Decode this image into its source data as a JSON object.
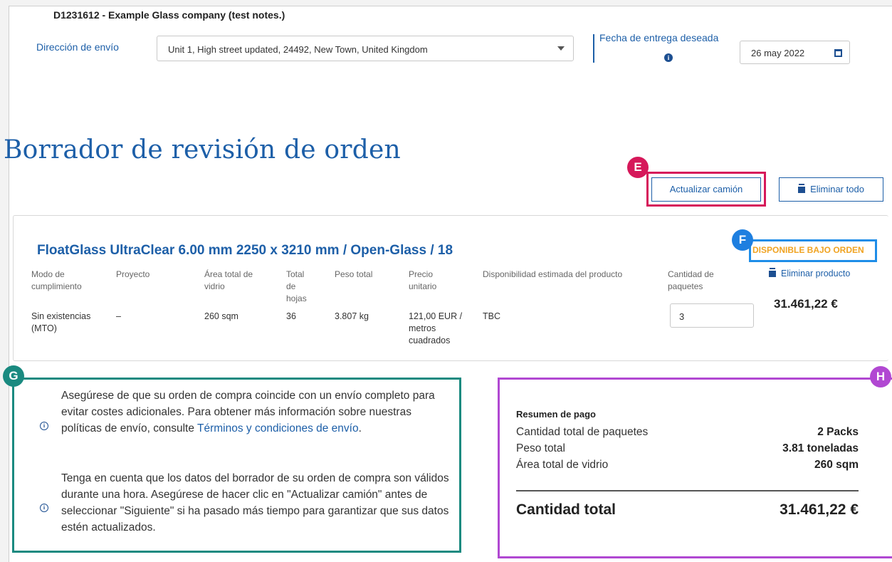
{
  "header": {
    "company": "D1231612 - Example Glass company (test notes.)",
    "shipping_label": "Dirección de envío",
    "shipping_value": "Unit 1, High street updated, 24492, New Town, United Kingdom",
    "delivery_date_label": "Fecha de entrega deseada",
    "delivery_date_value": "26 may 2022"
  },
  "page_title": "Borrador de revisión de orden",
  "badges": {
    "e": "E",
    "f": "F",
    "g": "G",
    "h": "H"
  },
  "actions": {
    "update_truck": "Actualizar camión",
    "delete_all": "Eliminar todo"
  },
  "product": {
    "title": "FloatGlass UltraClear 6.00 mm 2250 x 3210 mm / Open-Glass / 18",
    "availability_tag": "DISPONIBLE BAJO ORDEN",
    "delete_product": "Eliminar producto",
    "line_total": "31.461,22 €",
    "columns": {
      "fulfillment_mode": {
        "header": "Modo de cumplimiento",
        "value": "Sin existencias (MTO)"
      },
      "project": {
        "header": "Proyecto",
        "value": "–"
      },
      "total_glass_area": {
        "header": "Área total de vidrio",
        "value": "260 sqm"
      },
      "total_sheets": {
        "header": "Total de hojas",
        "value": "36"
      },
      "total_weight": {
        "header": "Peso total",
        "value": "3.807 kg"
      },
      "unit_price": {
        "header": "Precio unitario",
        "value": "121,00 EUR / metros cuadrados"
      },
      "estimated_availability": {
        "header": "Disponibilidad estimada del producto",
        "value": "TBC"
      },
      "pack_quantity": {
        "header": "Cantidad de paquetes",
        "value": "3"
      }
    }
  },
  "notes": {
    "note1_text": "Asegúrese de que su orden de compra coincide con un envío completo para evitar costes adicionales. Para obtener más información sobre nuestras políticas de envío, consulte ",
    "note1_link": "Términos y condiciones de envío",
    "note1_end": ".",
    "note2_text": "Tenga en cuenta que los datos del borrador de su orden de compra son válidos durante una hora. Asegúrese de hacer clic en \"Actualizar camión\" antes de seleccionar \"Siguiente\" si ha pasado más tiempo para garantizar que sus datos estén actualizados."
  },
  "summary": {
    "title": "Resumen de pago",
    "rows": [
      {
        "label": "Cantidad total de paquetes",
        "value": "2 Packs"
      },
      {
        "label": "Peso total",
        "value": "3.81 toneladas"
      },
      {
        "label": "Área total de vidrio",
        "value": "260 sqm"
      }
    ],
    "total_label": "Cantidad total",
    "total_value": "31.461,22 €"
  }
}
